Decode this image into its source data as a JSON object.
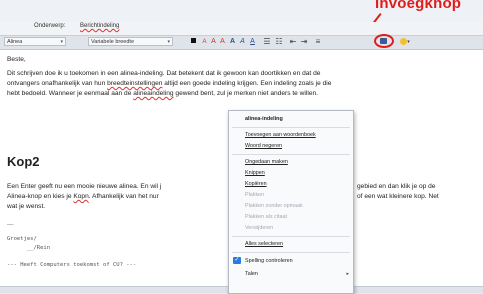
{
  "callout": {
    "text": "invoegknop",
    "color": "#e11b1b"
  },
  "header": {
    "subject_label": "Onderwerp:",
    "subject_value": "Berichtindeling"
  },
  "toolbar": {
    "paragraph_select": "Alinea",
    "font_select": "Variabele breedte",
    "buttons": [
      "A",
      "A",
      "A",
      "A",
      "A",
      "A"
    ],
    "accent": "#e11b1b"
  },
  "body": {
    "greeting": "Beste,",
    "para1_l1": "Dit schrijven doe ik u toekomen in een alinea-indeling. Dat betekent dat ik gewoon kan doortikken en dat de",
    "para1_l2a": "ontvangers onafhankelijk van hun ",
    "para1_l2_sq": "breedteinstellingen",
    "para1_l2b": " altijd een goede indeling krijgen. Een indeling zoals je die",
    "para1_l3a": "hebt bedoeld. Wanneer je eenmaal aan de ",
    "para1_l3_sq": "alineaindeling",
    "para1_l3b": " gewend bent, zul je merken niet anders te willen.",
    "heading": "Kop2",
    "para2_l1a": "Een Enter geeft nu een mooie nieuwe alinea. En wil j",
    "para2_l1b": "gebied en dan klik je op de",
    "para2_l2a": "Alinea-knop en kies je ",
    "para2_l2_sq": "Kopn",
    "para2_l2b": ". Afhankelijk van het nur",
    "para2_l2c": "of een wat kleinere kop. Net",
    "para2_l3": "wat je wenst.",
    "dash": "—",
    "sig1": "Groetjes/",
    "sig2": "      __/Rein",
    "footer": "--- Heeft Computers toekomst of CU? ---"
  },
  "context_menu": {
    "items": [
      {
        "label": "alinea-indeling",
        "bold": true
      },
      {
        "label": "Toevoegen aan woordenboek"
      },
      {
        "label": "Woord negeren"
      },
      {
        "label": "Ongedaan maken"
      },
      {
        "label": "Knippen"
      },
      {
        "label": "Kopiëren"
      },
      {
        "label": "Plakken",
        "disabled": true
      },
      {
        "label": "Plakken zonder opmaak",
        "disabled": true
      },
      {
        "label": "Plakken als citaat",
        "disabled": true
      },
      {
        "label": "Verwijderen",
        "disabled": true
      },
      {
        "label": "Alles selecteren"
      },
      {
        "label": "Spelling controleren",
        "checked": true
      },
      {
        "label": "Talen",
        "submenu": true
      }
    ]
  }
}
